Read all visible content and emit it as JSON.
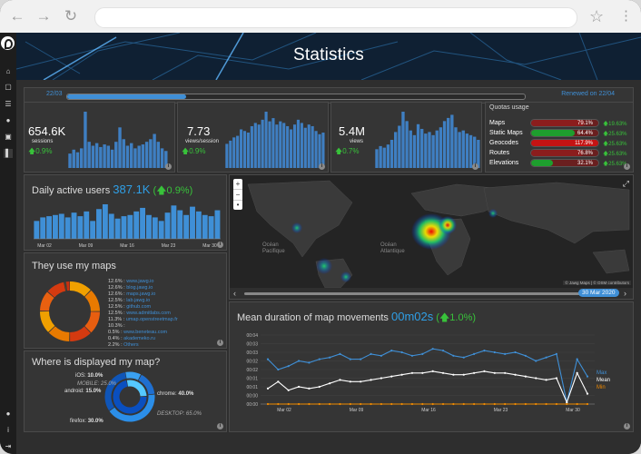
{
  "browser": {
    "back_icon": "arrow-left-icon",
    "forward_icon": "arrow-right-icon",
    "reload_icon": "reload-icon",
    "star_icon": "star-icon",
    "menu_icon": "kebab-menu-icon"
  },
  "sidebar": {
    "logo_icon": "jawg-logo-icon",
    "items": [
      {
        "icon": "home-icon"
      },
      {
        "icon": "map-icon"
      },
      {
        "icon": "database-icon"
      },
      {
        "icon": "globe-icon"
      },
      {
        "icon": "lock-icon"
      },
      {
        "icon": "chart-icon"
      }
    ],
    "bottom_items": [
      {
        "icon": "user-icon"
      },
      {
        "icon": "info-icon"
      },
      {
        "icon": "logout-icon"
      }
    ]
  },
  "header": {
    "title": "Statistics"
  },
  "period": {
    "start_label": "22/03",
    "renewed_label": "Renewed on 22/04",
    "progress": 0.26
  },
  "kpis": [
    {
      "value": "654.6K",
      "unit": "sessions",
      "delta": "0.9%",
      "bars": [
        22,
        28,
        24,
        30,
        86,
        40,
        34,
        38,
        32,
        36,
        34,
        28,
        40,
        62,
        44,
        34,
        38,
        30,
        34,
        36,
        40,
        44,
        52,
        40,
        30,
        26
      ]
    },
    {
      "value": "7.73",
      "unit": "views/session",
      "delta": "0.9%",
      "bars": [
        30,
        34,
        38,
        40,
        48,
        46,
        44,
        52,
        56,
        54,
        60,
        70,
        58,
        62,
        54,
        58,
        56,
        52,
        48,
        54,
        60,
        56,
        50,
        54,
        52,
        46,
        42,
        44
      ]
    },
    {
      "value": "5.4M",
      "unit": "views",
      "delta": "0.7%",
      "bars": [
        24,
        28,
        26,
        30,
        36,
        46,
        54,
        72,
        60,
        48,
        42,
        56,
        50,
        44,
        46,
        42,
        48,
        52,
        60,
        64,
        68,
        52,
        46,
        48,
        44,
        42,
        40,
        36
      ]
    }
  ],
  "quotas": {
    "title": "Quotas usage",
    "rows": [
      {
        "label": "Maps",
        "value": 0.791,
        "pct": "79.1%",
        "color": "#8b1d1d",
        "delta": "19.63%"
      },
      {
        "label": "Static Maps",
        "value": 0.644,
        "pct": "64.4%",
        "color": "#1e9e2e",
        "delta": "25.63%"
      },
      {
        "label": "Geocodes",
        "value": 1.0,
        "pct": "117.9%",
        "color": "#c41313",
        "delta": "25.63%"
      },
      {
        "label": "Routes",
        "value": 0.768,
        "pct": "76.8%",
        "color": "#8b1d1d",
        "delta": "25.63%"
      },
      {
        "label": "Elevations",
        "value": 0.321,
        "pct": "32.1%",
        "color": "#1e9e2e",
        "delta": "25.63%"
      }
    ]
  },
  "dau": {
    "title": "Daily active users",
    "value": "387.1K",
    "delta": "0.9%",
    "chart_data": {
      "type": "bar",
      "categories": [
        "Mar 02",
        "Mar 09",
        "Mar 16",
        "Mar 23",
        "Mar 30"
      ],
      "values": [
        30,
        36,
        38,
        40,
        42,
        36,
        44,
        38,
        46,
        30,
        50,
        58,
        42,
        34,
        38,
        40,
        46,
        52,
        40,
        36,
        30,
        44,
        56,
        48,
        40,
        54,
        46,
        40,
        38,
        48
      ]
    }
  },
  "usage": {
    "title": "They use my maps",
    "legend": [
      {
        "pct": "12.6%",
        "name": "www.jawg.io"
      },
      {
        "pct": "12.6%",
        "name": "blog.jawg.io"
      },
      {
        "pct": "12.6%",
        "name": "maps.jawg.io"
      },
      {
        "pct": "12.5%",
        "name": "lab.jawg.io"
      },
      {
        "pct": "12.5%",
        "name": "github.com"
      },
      {
        "pct": "12.5%",
        "name": "www.admitlabs.com"
      },
      {
        "pct": "11.3%",
        "name": "umap.openstreetmap.fr"
      },
      {
        "pct": "10.3%",
        "name": ""
      },
      {
        "pct": "0.5%",
        "name": "www.beneteau.com"
      },
      {
        "pct": "0.4%",
        "name": "akademeko.ru"
      },
      {
        "pct": "2.2%",
        "name": "Others"
      }
    ],
    "chart_data": {
      "type": "pie",
      "values": [
        12.6,
        12.6,
        12.6,
        12.5,
        12.5,
        12.5,
        11.3,
        10.3,
        0.5,
        0.4,
        2.2
      ],
      "colors": [
        "#f0a000",
        "#e87a00",
        "#e85e10",
        "#d43a10",
        "#e87a00",
        "#f0a000",
        "#e86010",
        "#d43a10",
        "#f0a000",
        "#e87a00",
        "#c83010"
      ]
    }
  },
  "displayed": {
    "title": "Where is displayed my map?",
    "labels": {
      "ios": "iOS:",
      "ios_pct": "10.0%",
      "mobile": "MOBILE: 25.0%",
      "android": "android:",
      "android_pct": "15.0%",
      "chrome": "chrome:",
      "chrome_pct": "40.0%",
      "desktop": "DESKTOP: 65.0%",
      "firefox": "firefox:",
      "firefox_pct": "30.0%"
    },
    "chart_data": {
      "type": "pie",
      "inner": [
        {
          "name": "MOBILE",
          "value": 25
        },
        {
          "name": "DESKTOP",
          "value": 65
        }
      ],
      "outer": [
        {
          "name": "iOS",
          "value": 10
        },
        {
          "name": "android",
          "value": 15
        },
        {
          "name": "chrome",
          "value": 40
        },
        {
          "name": "firefox",
          "value": 30
        }
      ]
    }
  },
  "map": {
    "zoom_in": "+",
    "zoom_out": "−",
    "locate": "•",
    "fullscreen_icon": "fullscreen-icon",
    "labels": {
      "pacific": "Océan Pacifique",
      "atlantic": "Océan Atlantique"
    },
    "attribution": "© Jawg Maps | © OSM contributors",
    "date_label": "30 Mar 2020"
  },
  "duration": {
    "title": "Mean duration of map movements",
    "value": "00m02s",
    "delta": "1.0%",
    "legend": {
      "max": "Max",
      "mean": "Mean",
      "min": "Min"
    },
    "colors": {
      "max": "#3f8fd6",
      "mean": "#ffffff",
      "min": "#f08a00"
    },
    "chart_data": {
      "type": "line",
      "x": [
        "Mar 02",
        "Mar 09",
        "Mar 16",
        "Mar 23",
        "Mar 30"
      ],
      "yticks": [
        "00:04",
        "00:03",
        "00:03",
        "00:02",
        "00:02",
        "00:01",
        "00:01",
        "00:00",
        "00:00"
      ],
      "series": [
        {
          "name": "Max",
          "values": [
            2.6,
            2.0,
            2.2,
            2.5,
            2.4,
            2.6,
            2.7,
            2.9,
            2.6,
            2.6,
            2.9,
            2.8,
            3.1,
            3.0,
            2.8,
            2.9,
            3.2,
            3.1,
            2.8,
            2.7,
            2.9,
            3.1,
            3.0,
            2.9,
            3.0,
            2.8,
            2.5,
            2.7,
            2.9,
            0.1,
            2.6,
            1.6
          ]
        },
        {
          "name": "Mean",
          "values": [
            0.9,
            1.3,
            0.8,
            1.0,
            0.9,
            1.0,
            1.2,
            1.4,
            1.3,
            1.3,
            1.4,
            1.5,
            1.6,
            1.7,
            1.8,
            1.8,
            1.9,
            1.8,
            1.7,
            1.7,
            1.8,
            1.9,
            1.8,
            1.8,
            1.7,
            1.6,
            1.5,
            1.4,
            1.5,
            0.1,
            1.8,
            0.6
          ]
        },
        {
          "name": "Min",
          "values": [
            0,
            0,
            0,
            0,
            0,
            0,
            0,
            0,
            0,
            0,
            0,
            0,
            0,
            0,
            0,
            0,
            0,
            0,
            0,
            0,
            0,
            0,
            0,
            0,
            0,
            0,
            0,
            0,
            0,
            0,
            0,
            0
          ]
        }
      ]
    }
  }
}
